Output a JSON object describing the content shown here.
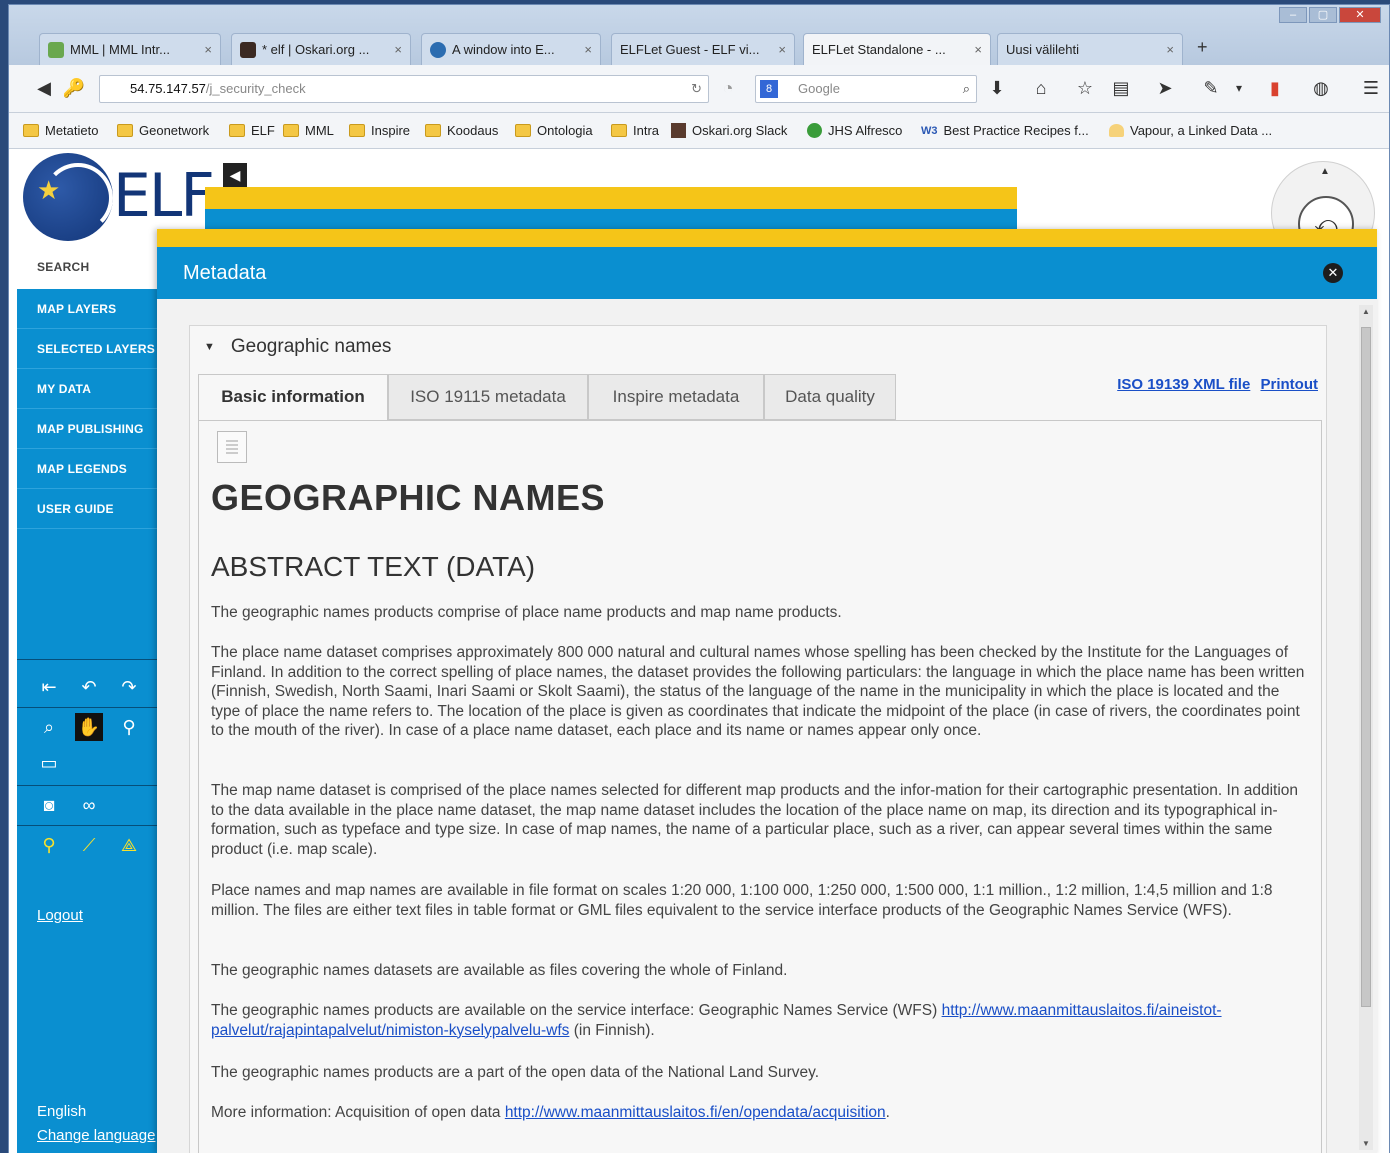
{
  "browser": {
    "window_controls": [
      "–",
      "▢",
      "✕"
    ],
    "tabs": [
      {
        "label": "MML | MML Intr...",
        "close": "×",
        "color": "#6aa84f"
      },
      {
        "label": "* elf | Oskari.org ...",
        "close": "×",
        "color": "#3c2a22"
      },
      {
        "label": "A window into E...",
        "close": "×",
        "color": "#2b6cb0"
      },
      {
        "label": "ELFLet Guest - ELF vi...",
        "close": "×",
        "color": "#e0e0e0"
      },
      {
        "label": "ELFLet Standalone - ...",
        "close": "×",
        "color": "#e0e0e0"
      },
      {
        "label": "Uusi välilehti",
        "close": "×",
        "color": "#e0e0e0"
      }
    ],
    "new_tab": "+",
    "url_host": "54.75.147.57",
    "url_path": "/j_security_check",
    "search_placeholder": "Google",
    "bookmarks": [
      {
        "label": "Metatieto",
        "icon": "folder-icon"
      },
      {
        "label": "Geonetwork",
        "icon": "folder-icon"
      },
      {
        "label": "ELF",
        "icon": "folder-icon"
      },
      {
        "label": "MML",
        "icon": "folder-icon"
      },
      {
        "label": "Inspire",
        "icon": "folder-icon"
      },
      {
        "label": "Koodaus",
        "icon": "folder-icon"
      },
      {
        "label": "Ontologia",
        "icon": "folder-icon"
      },
      {
        "label": "Intra",
        "icon": "folder-icon"
      },
      {
        "label": "Oskari.org Slack",
        "icon": "slack-icon"
      },
      {
        "label": "JHS Alfresco",
        "icon": "alfresco-icon"
      },
      {
        "label": "Best Practice Recipes f...",
        "icon": "w3c-icon"
      },
      {
        "label": "Vapour, a Linked Data ...",
        "icon": "vapour-icon"
      }
    ]
  },
  "app": {
    "logo_text": "ELF",
    "sidebar": {
      "search": "SEARCH",
      "items": [
        "MAP LAYERS",
        "SELECTED LAYERS",
        "MY DATA",
        "MAP PUBLISHING",
        "MAP LEGENDS",
        "USER GUIDE"
      ],
      "logout": "Logout",
      "language": "English",
      "change_language": "Change language"
    },
    "colors": {
      "blue": "#0a8fd0",
      "yellow": "#f5c518",
      "link": "#1a4fc7"
    }
  },
  "metadata": {
    "header": "Metadata",
    "section_title": "Geographic names",
    "links": [
      "ISO 19139 XML file",
      "Printout"
    ],
    "tabs": [
      "Basic information",
      "ISO 19115 metadata",
      "Inspire metadata",
      "Data quality"
    ],
    "title": "GEOGRAPHIC NAMES",
    "abstract_heading": "ABSTRACT TEXT (DATA)",
    "paragraphs": [
      "The geographic names products comprise of place name products and map name products.",
      "The place name dataset comprises approximately 800 000 natural and cultural names whose spelling has been checked by the Institute for the Languages of Finland. In addition to the correct spelling of place names, the dataset provides the following particulars: the language in which the place name has been written (Finnish, Swedish, North Saami, Inari Saami or Skolt Saami), the status of the language of the name in the municipality in which the place is located and the type of place the name refers to. The location of the place is given as coordinates that indicate the midpoint of the place (in case of rivers, the coordinates point to the mouth of the river). In case of a place name dataset, each place and its name or names appear only once.",
      "The map name dataset is comprised of the place names selected for different map products and the infor-mation for their cartographic presentation. In addition to the data available in the place name dataset, the map name dataset includes the location of the place name on map, its direction and its typographical in-formation, such as typeface and type size. In case of map names, the name of a particular place, such as a river, can appear several times within the same product (i.e. map scale).",
      "Place names and map names are available in file format on scales 1:20 000, 1:100 000, 1:250 000, 1:500 000, 1:1 million., 1:2 million, 1:4,5 million and 1:8 million. The files are either text files in table format or GML files equivalent to the service interface products of the Geographic Names Service (WFS).",
      "The geographic names datasets are available as files covering the whole of Finland."
    ],
    "service_text": "The geographic names products are available on the service interface: Geographic Names Service (WFS) ",
    "service_link": "http://www.maanmittauslaitos.fi/aineistot-palvelut/rajapintapalvelut/nimiston-kyselypalvelu-wfs",
    "service_suffix": " (in Finnish).",
    "open_data_text": "The geographic names products are a part of the open data of the National Land Survey.",
    "more_info_text": "More information: Acquisition of open data ",
    "more_info_link": "http://www.maanmittauslaitos.fi/en/opendata/acquisition",
    "more_info_suffix": "."
  }
}
